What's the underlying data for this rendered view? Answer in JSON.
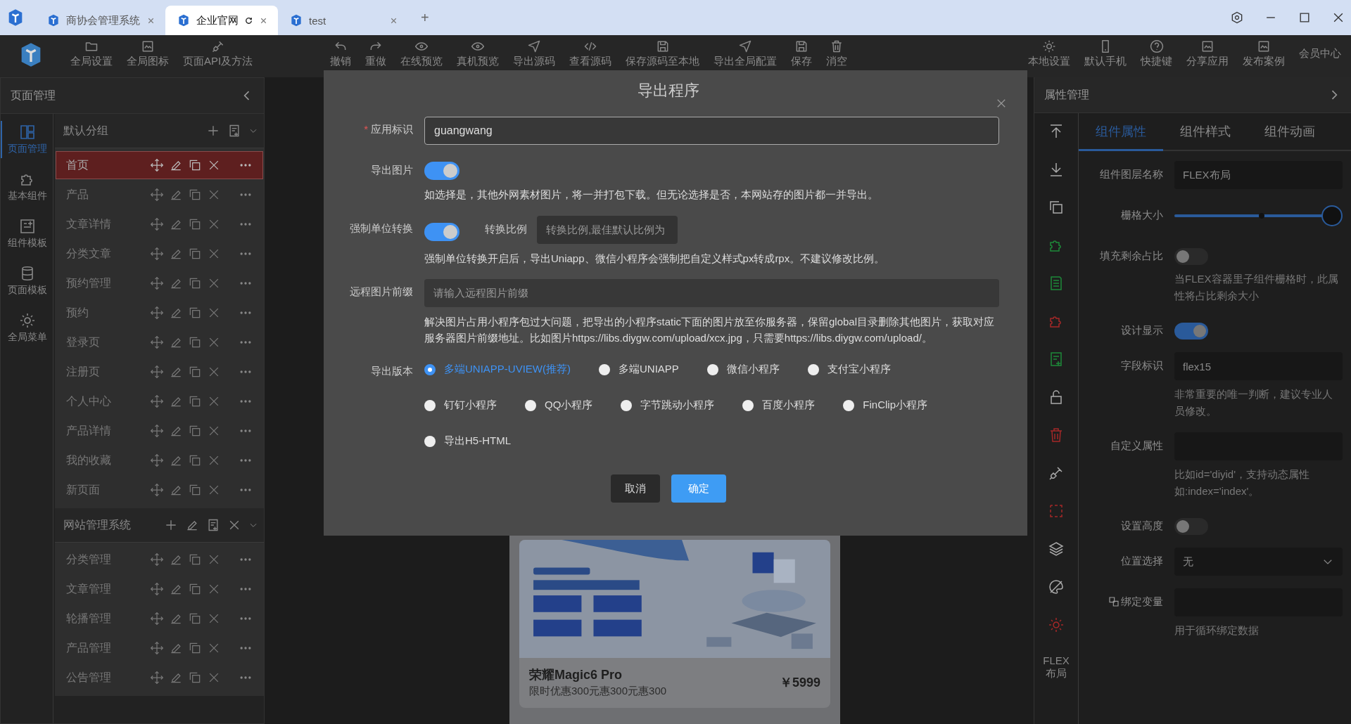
{
  "browser_tabs": [
    {
      "title": "商协会管理系统",
      "selected": false
    },
    {
      "title": "企业官网",
      "selected": true
    },
    {
      "title": "test",
      "selected": false
    }
  ],
  "new_tab": "+",
  "toolbar": {
    "left": [
      "全局设置",
      "全局图标",
      "页面API及方法"
    ],
    "center": [
      "撤销",
      "重做",
      "在线预览",
      "真机预览",
      "导出源码",
      "查看源码",
      "保存源码至本地",
      "导出全局配置",
      "保存",
      "消空"
    ],
    "right": [
      "本地设置",
      "默认手机",
      "快捷键",
      "分享应用",
      "发布案例"
    ],
    "member": "会员中心"
  },
  "left_panel": {
    "title": "页面管理",
    "nav": [
      {
        "label": "页面管理",
        "selected": true
      },
      {
        "label": "基本组件",
        "selected": false
      },
      {
        "label": "组件模板",
        "selected": false
      },
      {
        "label": "页面模板",
        "selected": false
      },
      {
        "label": "全局菜单",
        "selected": false
      }
    ],
    "groups": [
      {
        "name": "默认分组",
        "kind": "default",
        "pages": [
          {
            "name": "首页",
            "selected": true
          },
          {
            "name": "产品",
            "selected": false
          },
          {
            "name": "文章详情",
            "selected": false
          },
          {
            "name": "分类文章",
            "selected": false
          },
          {
            "name": "预约管理",
            "selected": false
          },
          {
            "name": "预约",
            "selected": false
          },
          {
            "name": "登录页",
            "selected": false
          },
          {
            "name": "注册页",
            "selected": false
          },
          {
            "name": "个人中心",
            "selected": false
          },
          {
            "name": "产品详情",
            "selected": false
          },
          {
            "name": "我的收藏",
            "selected": false
          },
          {
            "name": "新页面",
            "selected": false
          }
        ]
      },
      {
        "name": "网站管理系统",
        "kind": "custom",
        "pages": [
          {
            "name": "分类管理",
            "selected": false
          },
          {
            "name": "文章管理",
            "selected": false
          },
          {
            "name": "轮播管理",
            "selected": false
          },
          {
            "name": "产品管理",
            "selected": false
          },
          {
            "name": "公告管理",
            "selected": false
          }
        ]
      }
    ]
  },
  "preview": {
    "product": {
      "name": "荣耀Magic6 Pro",
      "subtitle": "限时优惠300元惠300元惠300",
      "price": "￥5999"
    }
  },
  "dialog": {
    "title": "导出程序",
    "app_id": {
      "label": "应用标识",
      "required_mark": "*",
      "value": "guangwang"
    },
    "export_images": {
      "label": "导出图片",
      "on": true,
      "hint": "如选择是，其他外网素材图片，将一并打包下载。但无论选择是否，本网站存的图片都一并导出。"
    },
    "unit_convert": {
      "label": "强制单位转换",
      "on": true,
      "ratio_label": "转换比例",
      "ratio_placeholder": "转换比例,最佳默认比例为",
      "hint": "强制单位转换开启后，导出Uniapp、微信小程序会强制把自定义样式px转成rpx。不建议修改比例。"
    },
    "remote_prefix": {
      "label": "远程图片前缀",
      "placeholder": "请输入远程图片前缀",
      "hint": "解决图片占用小程序包过大问题，把导出的小程序static下面的图片放至你服务器，保留global目录删除其他图片，获取对应服务器图片前缀地址。比如图片https://libs.diygw.com/upload/xcx.jpg，只需要https://libs.diygw.com/upload/。"
    },
    "version": {
      "label": "导出版本",
      "options": [
        {
          "label": "多端UNIAPP-UVIEW(推荐)",
          "selected": true
        },
        {
          "label": "多端UNIAPP",
          "selected": false
        },
        {
          "label": "微信小程序",
          "selected": false
        },
        {
          "label": "支付宝小程序",
          "selected": false
        },
        {
          "label": "钉钉小程序",
          "selected": false
        },
        {
          "label": "QQ小程序",
          "selected": false
        },
        {
          "label": "字节跳动小程序",
          "selected": false
        },
        {
          "label": "百度小程序",
          "selected": false
        },
        {
          "label": "FinClip小程序",
          "selected": false
        },
        {
          "label": "导出H5-HTML",
          "selected": false
        }
      ]
    },
    "buttons": [
      {
        "label": "取消",
        "kind": "secondary"
      },
      {
        "label": "确定",
        "kind": "primary"
      }
    ]
  },
  "right_panel": {
    "title": "属性管理",
    "component_label": "FLEX 布局",
    "tabs": [
      {
        "label": "组件属性",
        "selected": true
      },
      {
        "label": "组件样式",
        "selected": false
      },
      {
        "label": "组件动画",
        "selected": false
      }
    ],
    "fields": [
      {
        "kind": "input",
        "label": "组件图层名称",
        "value": "FLEX布局"
      },
      {
        "kind": "slider",
        "label": "栅格大小",
        "level": 1
      },
      {
        "kind": "switch",
        "label": "填充剩余占比",
        "on": false,
        "hint": "当FLEX容器里子组件栅格时，此属性将占比剩余大小"
      },
      {
        "kind": "switch",
        "label": "设计显示",
        "on": true
      },
      {
        "kind": "input",
        "label": "字段标识",
        "value": "flex15",
        "hint": "非常重要的唯一判断，建议专业人员修改。"
      },
      {
        "kind": "input",
        "label": "自定义属性",
        "hint": "比如id='diyid'，支持动态属性如:index='index'。"
      },
      {
        "kind": "switch",
        "label": "设置高度",
        "on": false
      },
      {
        "kind": "select",
        "label": "位置选择",
        "value": "无"
      },
      {
        "kind": "bind",
        "label": "绑定变量",
        "hint": "用于循环绑定数据"
      }
    ]
  }
}
